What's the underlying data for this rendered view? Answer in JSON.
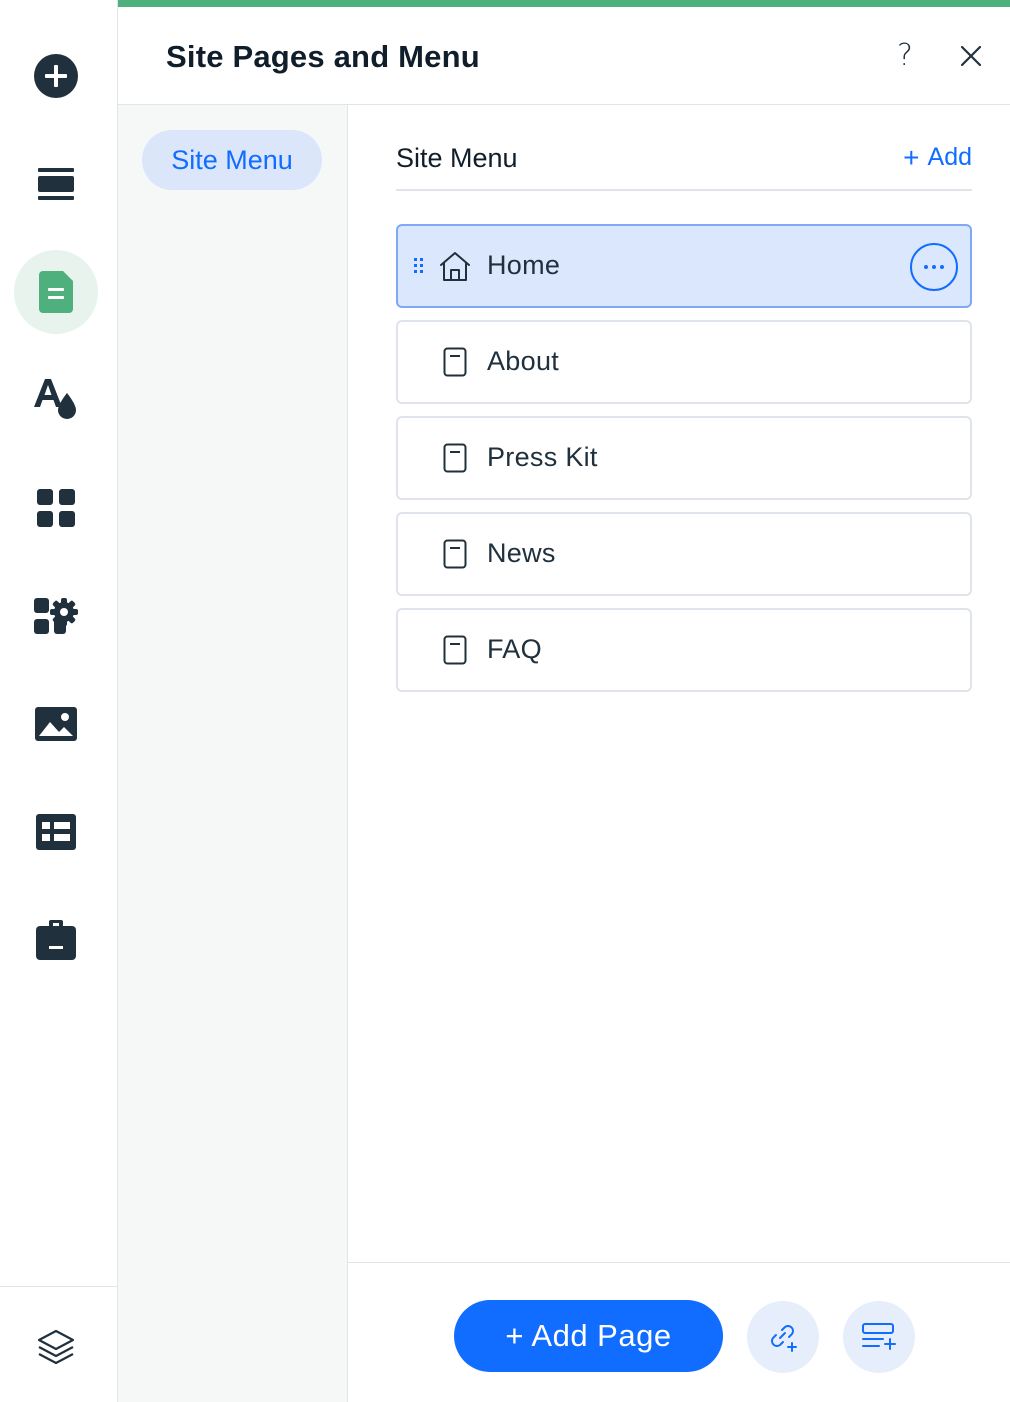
{
  "panel": {
    "title": "Site Pages and Menu",
    "help_label": "?"
  },
  "subnav": {
    "items": [
      {
        "label": "Site Menu",
        "active": true
      }
    ]
  },
  "section": {
    "title": "Site Menu",
    "add_label": "Add",
    "add_plus": "+"
  },
  "pages": [
    {
      "label": "Home",
      "type": "home",
      "selected": true
    },
    {
      "label": "About",
      "type": "page",
      "selected": false
    },
    {
      "label": "Press Kit",
      "type": "page",
      "selected": false
    },
    {
      "label": "News",
      "type": "page",
      "selected": false
    },
    {
      "label": "FAQ",
      "type": "page",
      "selected": false
    }
  ],
  "footer": {
    "add_page_label": "+ Add Page"
  },
  "rail": {
    "items": [
      {
        "icon": "add-elements-icon"
      },
      {
        "icon": "sections-icon"
      },
      {
        "icon": "pages-icon",
        "active": true
      },
      {
        "icon": "site-design-icon"
      },
      {
        "icon": "apps-icon"
      },
      {
        "icon": "business-apps-icon"
      },
      {
        "icon": "media-icon"
      },
      {
        "icon": "cms-icon"
      },
      {
        "icon": "portfolio-icon"
      },
      {
        "icon": "layers-icon"
      }
    ]
  },
  "colors": {
    "accent": "#4eb07d",
    "primary": "#116dff",
    "selected_bg": "#dbe7fd",
    "text": "#20303c"
  }
}
